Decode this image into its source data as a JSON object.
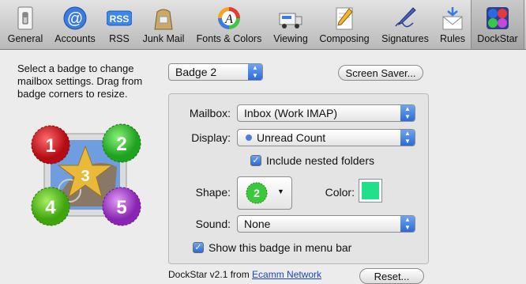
{
  "toolbar": {
    "items": [
      {
        "label": "General",
        "icon": "light-switch-icon"
      },
      {
        "label": "Accounts",
        "icon": "at-sign-icon"
      },
      {
        "label": "RSS",
        "icon": "rss-badge-icon"
      },
      {
        "label": "Junk Mail",
        "icon": "junk-mail-bag-icon"
      },
      {
        "label": "Fonts & Colors",
        "icon": "color-wheel-font-icon"
      },
      {
        "label": "Viewing",
        "icon": "mail-truck-icon"
      },
      {
        "label": "Composing",
        "icon": "pencil-paper-icon"
      },
      {
        "label": "Signatures",
        "icon": "pen-signature-icon"
      },
      {
        "label": "Rules",
        "icon": "rules-envelope-icon"
      },
      {
        "label": "DockStar",
        "icon": "dockstar-badges-icon"
      }
    ],
    "selected": "DockStar",
    "rss_glyph": "RSS",
    "at_glyph": "@",
    "fonts_glyph": "A"
  },
  "instructions": "Select a badge to change mailbox settings.  Drag from badge corners to resize.",
  "badge_preview": {
    "badges": [
      {
        "number": "1",
        "color": "#d8141d"
      },
      {
        "number": "2",
        "color": "#3cc83c"
      },
      {
        "number": "3",
        "color": "#e9b93b"
      },
      {
        "number": "4",
        "color": "#5ecf1e"
      },
      {
        "number": "5",
        "color": "#b748d9"
      }
    ]
  },
  "badge_select": {
    "value": "Badge 2"
  },
  "screen_saver_button": "Screen Saver...",
  "settings": {
    "mailbox_label": "Mailbox:",
    "mailbox_value": "Inbox (Work IMAP)",
    "display_label": "Display:",
    "display_value": "Unread Count",
    "include_nested_label": "Include nested folders",
    "include_nested_checked": true,
    "shape_label": "Shape:",
    "shape_number": "2",
    "shape_color": "#3cc83c",
    "color_label": "Color:",
    "color_value": "#22e08a",
    "sound_label": "Sound:",
    "sound_value": "None",
    "show_in_menu_label": "Show this badge in menu bar",
    "show_in_menu_checked": true
  },
  "footer": {
    "prefix": "DockStar v2.1 from ",
    "link": "Ecamm Network"
  },
  "reset_button": "Reset..."
}
